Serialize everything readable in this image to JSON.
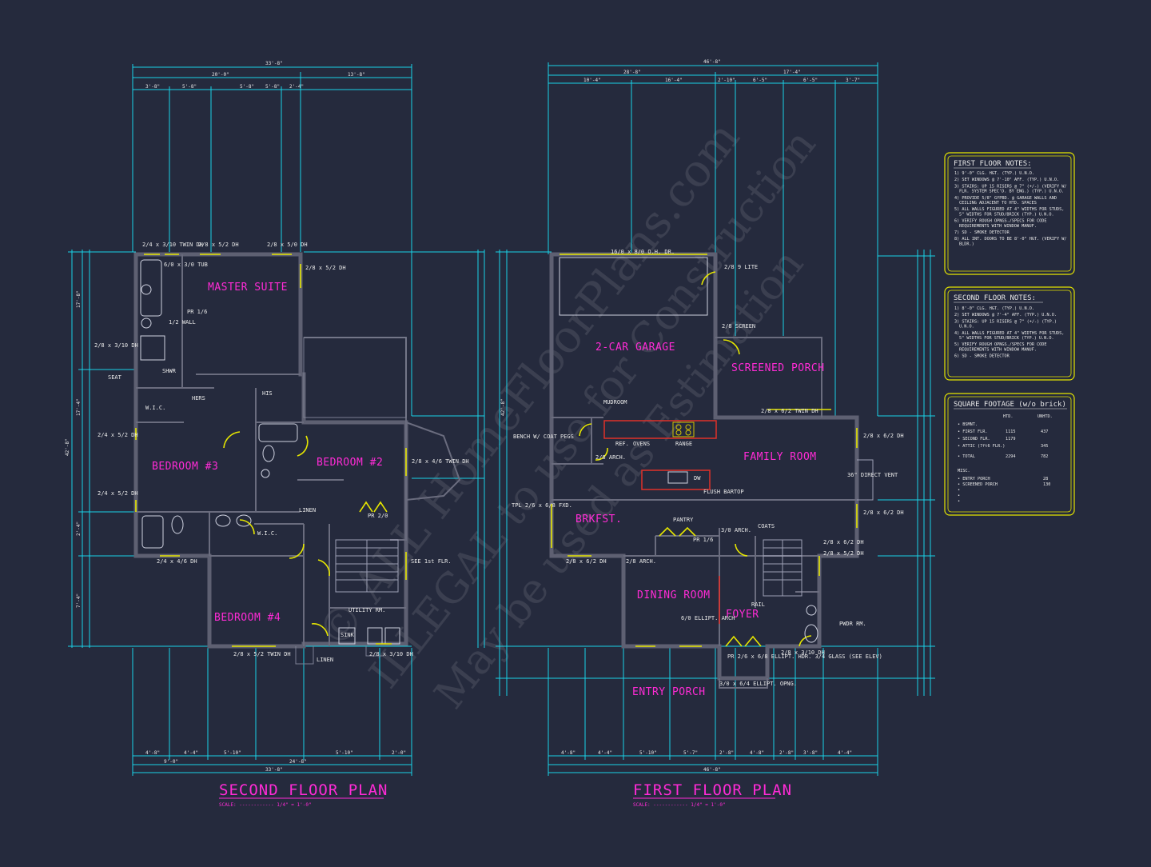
{
  "colors": {
    "background": "#252a3d",
    "dimension": "#19d2e8",
    "wall": "#5e6072",
    "room_label": "#ff2bd6",
    "notes_border": "#e6e600",
    "text": "#e8e8e8"
  },
  "watermark": {
    "line1": "© ALL HomeFloorPlans.com",
    "line2": "ILLEGAL to use for Construction",
    "line3": "May be used as Estimation"
  },
  "second_floor": {
    "title": "SECOND FLOOR PLAN",
    "scale": "SCALE: ------------ 1/4\" = 1'-0\"",
    "overall_top": "33'-8\"",
    "overall_bottom": "33'-8\"",
    "overall_side": "42'-8\"",
    "top_dims": [
      "20'-0\"",
      "13'-8\""
    ],
    "top_sub_dims": [
      "3'-8\"",
      "5'-8\"",
      "5'-8\"",
      "5'-8\"",
      "2'-4\""
    ],
    "bottom_dims": [
      "4'-8\"",
      "4'-4\"",
      "5'-10\"",
      "5'-10\"",
      "2'-0\""
    ],
    "bottom_sub_dims": [
      "9'-0\"",
      "24'-8\""
    ],
    "left_dims": [
      "17'-8\"",
      "2'-4\"",
      "17'-4\"",
      "7'-4\""
    ],
    "rooms": {
      "master": "MASTER SUITE",
      "bed2": "BEDROOM #2",
      "bed3": "BEDROOM #3",
      "bed4": "BEDROOM #4"
    },
    "labels": {
      "tub": "6/0 x 3/0 TUB",
      "half_wall": "1/2 WALL",
      "pr16": "PR 1/6",
      "seat": "SEAT",
      "shwr": "SHWR",
      "hers": "HERS",
      "his": "HIS",
      "wic1": "W.I.C.",
      "wic2": "W.I.C.",
      "linen1": "LINEN",
      "linen2": "LINEN",
      "utility": "UTILITY RM.",
      "sink": "SINK",
      "see_1st": "SEE 1st FLR.",
      "pr20": "PR 2/0",
      "w1": "2/4 x 3/10 TWIN DH",
      "w2": "2/8 x 5/2 DH",
      "w3": "2/8 x 5/0 DH",
      "w4": "2/8 x 5/2 DH",
      "w5": "2/8 x 3/10 DH",
      "w6": "2/4 x 5/2 DH",
      "w7": "2/4 x 5/2 DH",
      "w8": "2/8 x 4/6 TWIN DH",
      "w9": "2/4 x 4/6 DH",
      "w10": "2/8 x 5/2 TWIN DH",
      "w11": "2/8 x 3/10 DH"
    }
  },
  "first_floor": {
    "title": "FIRST FLOOR PLAN",
    "scale": "SCALE: ------------ 1/4\" = 1'-0\"",
    "overall_top": "46'-8\"",
    "overall_bottom": "46'-8\"",
    "overall_side": "42'-8\"",
    "top_dims": [
      "28'-8\"",
      "17'-4\""
    ],
    "top_sub_dims": [
      "10'-4\"",
      "16'-4\"",
      "2'-10\"",
      "6'-5\"",
      "6'-5\"",
      "3'-7\""
    ],
    "bottom_dims": [
      "4'-8\"",
      "4'-4\"",
      "5'-10\"",
      "5'-7\"",
      "2'-8\"",
      "4'-8\"",
      "2'-8\"",
      "3'-8\"",
      "4'-4\""
    ],
    "bottom_sub_dims": [
      "46'-8\""
    ],
    "rooms": {
      "garage": "2-CAR GARAGE",
      "screened": "SCREENED PORCH",
      "family": "FAMILY ROOM",
      "brkfst": "BRKFST.",
      "dining": "DINING ROOM",
      "foyer": "FOYER",
      "entry": "ENTRY PORCH"
    },
    "labels": {
      "garage_door": "16/0 x 8/0 O.H. DR.",
      "door28": "2/8 9 LITE",
      "screen": "2/8 SCREEN",
      "mudroom": "MUDROOM",
      "bench": "BENCH W/ COAT PEGS",
      "ref": "REF.",
      "ovens": "OVENS",
      "range": "RANGE",
      "flush": "FLUSH BARTOP",
      "dw": "DW",
      "hearth": "36\" DIRECT VENT",
      "pantry": "PANTRY",
      "coats": "COATS",
      "pr16": "PR 1/6",
      "arch": "3/0 ARCH.",
      "ellipt": "6/0 ELLIPT. ARCH",
      "rail": "RAIL",
      "pwdr": "PWDR RM.",
      "entry_door": "PR 2/6 x 6/8 ELLIPT. HDR. 3/4 GLASS (SEE ELEV)",
      "ellipt_opng": "3/0 x 6/4 ELLIPT. OPNG.",
      "twin1": "2/8 x 6/2 TWIN DH",
      "dh1": "2/8 x 6/2 DH",
      "dh2": "2/8 x 6/2 DH",
      "dh3": "2/8 x 6/2 DH",
      "dh4": "2/8 x 6/2 DH",
      "dh5": "2/8 x 5/2 DH",
      "dh6": "2/8 x 3/10 DH",
      "tpl": "TPL 2/6 x 6/8 FXD.",
      "arch28": "2/8 ARCH.",
      "arch28b": "2/8 ARCH."
    }
  },
  "notes": {
    "first": {
      "title": "FIRST FLOOR NOTES:",
      "items": [
        "1) 9'-0\" CLG. HGT. (TYP.) U.N.O.",
        "2) SET WINDOWS @ 7'-10\" AFF. (TYP.) U.N.O.",
        "3) STAIRS: UP 15 RISERS @ 7\" (+/-) (VERIFY W/ FLR. SYSTEM SPEC'D. BY ENG.) (TYP.) U.N.O.",
        "4) PROVIDE 5/8\" GYPBD. @ GARAGE WALLS AND CEILING ADJACENT TO HTD. SPACES",
        "5) ALL WALLS FIGURED AT 4\" WIDTHS FOR STUDS, 5\" WIDTHS FOR STUD/BRICK (TYP.) U.N.O.",
        "6) VERIFY ROUGH OPNGS./SPECS FOR CODE REQUIREMENTS WITH WINDOW MANUF.",
        "7) SD - SMOKE DETECTOR",
        "8) ALL INT. DOORS TO BE 8'-0\" HGT. (VERIFY W/ BLDR.)"
      ]
    },
    "second": {
      "title": "SECOND FLOOR NOTES:",
      "items": [
        "1) 8'-0\" CLG. HGT. (TYP.) U.N.O.",
        "2) SET WINDOWS @ 7'-4\" AFF. (TYP.) U.N.O.",
        "3) STAIRS: UP 15 RISERS @ 7\" (+/-) (TYP.) U.N.O.",
        "4) ALL WALLS FIGURED AT 4\" WIDTHS FOR STUDS, 5\" WIDTHS FOR STUD/BRICK (TYP.) U.N.O.",
        "5) VERIFY ROUGH OPNGS./SPECS FOR CODE REQUIREMENTS WITH WINDOW MANUF.",
        "6) SD - SMOKE DETECTOR"
      ]
    },
    "sqft": {
      "title": "SQUARE FOOTAGE (w/o brick)",
      "col_htd": "HTD.",
      "col_unhtd": "UNHTD.",
      "rows": [
        {
          "label": "BSMNT.",
          "htd": "",
          "unhtd": ""
        },
        {
          "label": "FIRST FLR.",
          "htd": "1115",
          "unhtd": "437"
        },
        {
          "label": "SECOND FLR.",
          "htd": "1179",
          "unhtd": ""
        },
        {
          "label": "ATTIC (7ft6 FLR.)",
          "htd": "",
          "unhtd": "345"
        },
        {
          "label": "TOTAL",
          "htd": "2294",
          "unhtd": "782"
        }
      ],
      "misc_title": "MISC.",
      "misc_rows": [
        {
          "label": "ENTRY PORCH",
          "val": "28"
        },
        {
          "label": "SCREENED PORCH",
          "val": "130"
        }
      ]
    }
  }
}
